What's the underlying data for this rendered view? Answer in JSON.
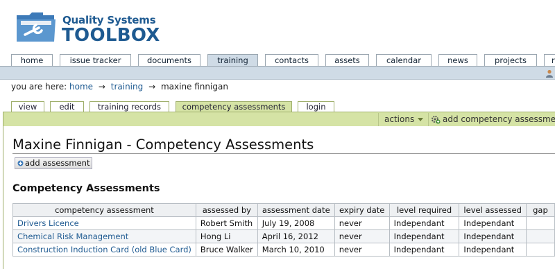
{
  "logo": {
    "line1": "Quality Systems",
    "line2": "TOOLBOX"
  },
  "main_nav": [
    {
      "label": "home",
      "active": false
    },
    {
      "label": "issue tracker",
      "active": false
    },
    {
      "label": "documents",
      "active": false
    },
    {
      "label": "training",
      "active": true
    },
    {
      "label": "contacts",
      "active": false
    },
    {
      "label": "assets",
      "active": false
    },
    {
      "label": "calendar",
      "active": false
    },
    {
      "label": "news",
      "active": false
    },
    {
      "label": "projects",
      "active": false
    },
    {
      "label": "r",
      "active": false
    }
  ],
  "breadcrumb": {
    "prefix": "you are here:",
    "items": [
      "home",
      "training"
    ],
    "current": "maxine finnigan",
    "separator": "→"
  },
  "sub_nav": [
    {
      "label": "view",
      "active": false
    },
    {
      "label": "edit",
      "active": false
    },
    {
      "label": "training records",
      "active": false
    },
    {
      "label": "competency assessments",
      "active": true
    },
    {
      "label": "login",
      "active": false
    }
  ],
  "action_bar": {
    "actions_label": "actions",
    "add_competency_label": "add competency assessment"
  },
  "page": {
    "title": "Maxine Finnigan - Competency Assessments",
    "add_button": "add assessment",
    "section_title": "Competency Assessments"
  },
  "table": {
    "headers": [
      "competency assessment",
      "assessed by",
      "assessment date",
      "expiry date",
      "level required",
      "level assessed",
      "gap"
    ],
    "rows": [
      [
        "Drivers Licence",
        "Robert Smith",
        "July 19, 2008",
        "never",
        "Independant",
        "Independant",
        ""
      ],
      [
        "Chemical Risk Management",
        "Hong Li",
        "April 16, 2012",
        "never",
        "Independant",
        "Independant",
        ""
      ],
      [
        "Construction Induction Card (old Blue Card)",
        "Bruce Walker",
        "March 10, 2010",
        "never",
        "Independant",
        "Independant",
        ""
      ]
    ]
  },
  "colors": {
    "brand_blue": "#1e5a91",
    "nav_bar": "#cfdbe6",
    "sub_nav_green": "#d5e3a5"
  },
  "icons": [
    "folder-wrench-logo-icon",
    "user-icon",
    "caret-down-icon",
    "gear-add-icon",
    "plus-icon"
  ]
}
